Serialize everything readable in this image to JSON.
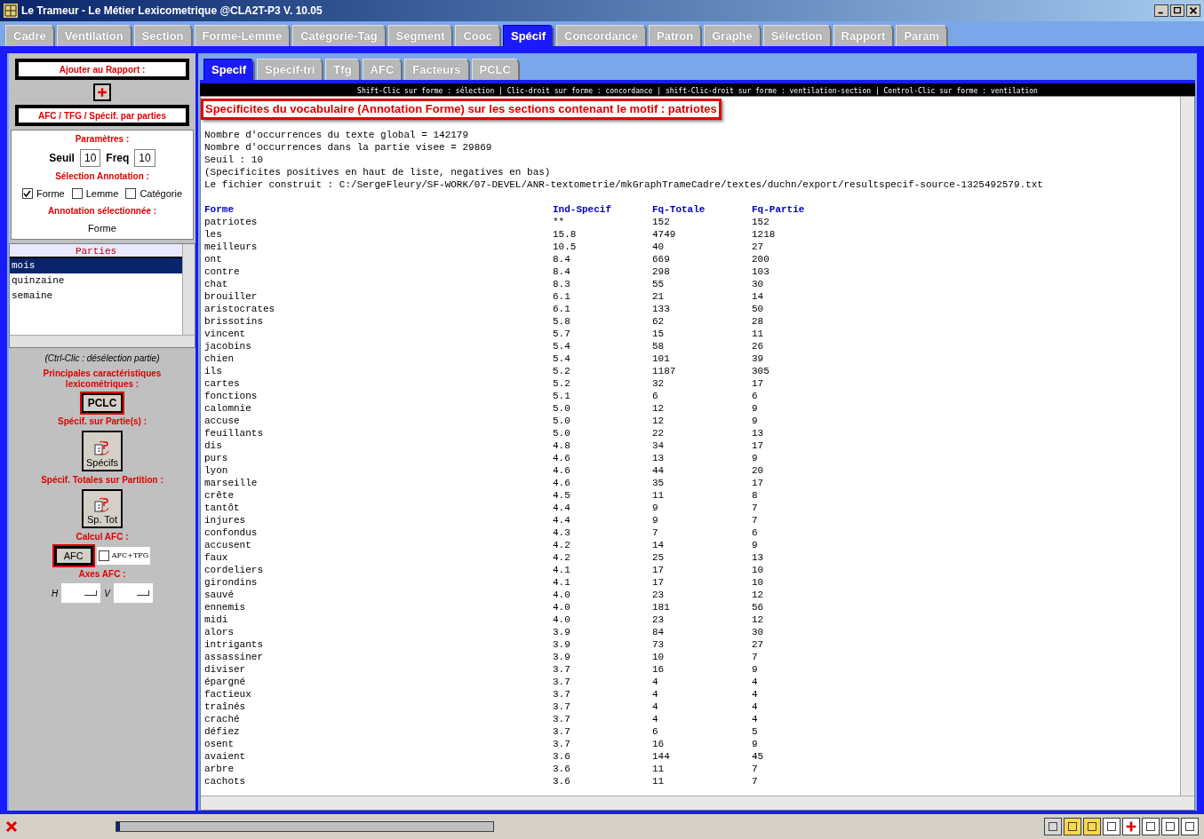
{
  "window": {
    "title": "Le Trameur - Le Métier Lexicometrique @CLA2T-P3 V. 10.05"
  },
  "tabs": [
    {
      "label": "Cadre",
      "selected": false
    },
    {
      "label": "Ventilation",
      "selected": false
    },
    {
      "label": "Section",
      "selected": false
    },
    {
      "label": "Forme-Lemme",
      "selected": false
    },
    {
      "label": "Catégorie-Tag",
      "selected": false
    },
    {
      "label": "Segment",
      "selected": false
    },
    {
      "label": "Cooc",
      "selected": false
    },
    {
      "label": "Spécif",
      "selected": true
    },
    {
      "label": "Concordance",
      "selected": false
    },
    {
      "label": "Patron",
      "selected": false
    },
    {
      "label": "Graphe",
      "selected": false
    },
    {
      "label": "Sélection",
      "selected": false
    },
    {
      "label": "Rapport",
      "selected": false
    },
    {
      "label": "Param",
      "selected": false
    }
  ],
  "sidebar": {
    "add_to_report": "Ajouter au Rapport :",
    "afc_title": "AFC / TFG / Spécif. par parties",
    "params_label": "Paramètres :",
    "seuil_label": "Seuil",
    "seuil_value": "10",
    "freq_label": "Freq",
    "freq_value": "10",
    "annotation_label": "Sélection Annotation :",
    "annotations": [
      {
        "label": "Forme",
        "checked": true
      },
      {
        "label": "Lemme",
        "checked": false
      },
      {
        "label": "Catégorie",
        "checked": false
      }
    ],
    "selected_annotation_label": "Annotation sélectionnée :",
    "selected_annotation": "Forme",
    "parts_header": "Parties",
    "parts": [
      {
        "label": "mois",
        "selected": true
      },
      {
        "label": "quinzaine",
        "selected": false
      },
      {
        "label": "semaine",
        "selected": false
      }
    ],
    "deselect_hint": "(Ctrl-Clic : désélection partie)",
    "pclc_label": "Principales caractéristiques lexicométriques :",
    "pclc_button": "PCLC",
    "specif_label": "Spécif. sur Partie(s) :",
    "specif_button": "Spécifs",
    "total_label": "Spécif. Totales sur Partition :",
    "total_button": "Sp. Tot",
    "afc_label": "Calcul AFC :",
    "afc_button": "AFC",
    "afc_tfg": {
      "label": "AFC+TFG",
      "checked": false
    },
    "axes_label": "Axes AFC :",
    "axis_h": "H",
    "axis_v": "V"
  },
  "status_bar": {
    "progress": {
      "level": 0.01
    }
  },
  "subtabs": [
    {
      "label": "Specif",
      "selected": true
    },
    {
      "label": "Specif-tri",
      "selected": false
    },
    {
      "label": "Tfg",
      "selected": false
    },
    {
      "label": "AFC",
      "selected": false
    },
    {
      "label": "Facteurs",
      "selected": false
    },
    {
      "label": "PCLC",
      "selected": false
    }
  ],
  "hint": "Shift-Clic sur forme : sélection | Clic-droit sur forme : concordance | shift-Clic-droit sur forme : ventilation-section | Control-Clic sur forme : ventilation",
  "result": {
    "heading": "Specificites du vocabulaire (Annotation Forme) sur les sections contenant le motif : patriotes",
    "info": [
      "Nombre d'occurrences du texte global = 142179",
      "Nombre d'occurrences dans la partie visee = 29869",
      "Seuil : 10",
      "(Specificites positives en haut de liste, negatives en bas)",
      "Le fichier construit : C:/SergeFleury/SF-WORK/07-DEVEL/ANR-textometrie/mkGraphTrameCadre/textes/duchn/export/resultspecif-source-1325492579.txt"
    ],
    "columns": [
      "Forme",
      "Ind-Specif",
      "Fq-Totale",
      "Fq-Partie"
    ],
    "rows": [
      [
        "patriotes",
        "**",
        "152",
        "152"
      ],
      [
        "les",
        "15.8",
        "4749",
        "1218"
      ],
      [
        "meilleurs",
        "10.5",
        "40",
        "27"
      ],
      [
        "ont",
        "8.4",
        "669",
        "200"
      ],
      [
        "contre",
        "8.4",
        "298",
        "103"
      ],
      [
        "chat",
        "8.3",
        "55",
        "30"
      ],
      [
        "brouiller",
        "6.1",
        "21",
        "14"
      ],
      [
        "aristocrates",
        "6.1",
        "133",
        "50"
      ],
      [
        "brissotins",
        "5.8",
        "62",
        "28"
      ],
      [
        "vincent",
        "5.7",
        "15",
        "11"
      ],
      [
        "jacobins",
        "5.4",
        "58",
        "26"
      ],
      [
        "chien",
        "5.4",
        "101",
        "39"
      ],
      [
        "ils",
        "5.2",
        "1187",
        "305"
      ],
      [
        "cartes",
        "5.2",
        "32",
        "17"
      ],
      [
        "fonctions",
        "5.1",
        "6",
        "6"
      ],
      [
        "calomnie",
        "5.0",
        "12",
        "9"
      ],
      [
        "accuse",
        "5.0",
        "12",
        "9"
      ],
      [
        "feuillants",
        "5.0",
        "22",
        "13"
      ],
      [
        "dis",
        "4.8",
        "34",
        "17"
      ],
      [
        "purs",
        "4.6",
        "13",
        "9"
      ],
      [
        "lyon",
        "4.6",
        "44",
        "20"
      ],
      [
        "marseille",
        "4.6",
        "35",
        "17"
      ],
      [
        "crête",
        "4.5",
        "11",
        "8"
      ],
      [
        "tantôt",
        "4.4",
        "9",
        "7"
      ],
      [
        "injures",
        "4.4",
        "9",
        "7"
      ],
      [
        "confondus",
        "4.3",
        "7",
        "6"
      ],
      [
        "accusent",
        "4.2",
        "14",
        "9"
      ],
      [
        "faux",
        "4.2",
        "25",
        "13"
      ],
      [
        "cordeliers",
        "4.1",
        "17",
        "10"
      ],
      [
        "girondins",
        "4.1",
        "17",
        "10"
      ],
      [
        "sauvé",
        "4.0",
        "23",
        "12"
      ],
      [
        "ennemis",
        "4.0",
        "181",
        "56"
      ],
      [
        "midi",
        "4.0",
        "23",
        "12"
      ],
      [
        "alors",
        "3.9",
        "84",
        "30"
      ],
      [
        "intrigants",
        "3.9",
        "73",
        "27"
      ],
      [
        "assassiner",
        "3.9",
        "10",
        "7"
      ],
      [
        "diviser",
        "3.7",
        "16",
        "9"
      ],
      [
        "épargné",
        "3.7",
        "4",
        "4"
      ],
      [
        "factieux",
        "3.7",
        "4",
        "4"
      ],
      [
        "traînés",
        "3.7",
        "4",
        "4"
      ],
      [
        "craché",
        "3.7",
        "4",
        "4"
      ],
      [
        "défiez",
        "3.7",
        "6",
        "5"
      ],
      [
        "osent",
        "3.7",
        "16",
        "9"
      ],
      [
        "avaient",
        "3.6",
        "144",
        "45"
      ],
      [
        "arbre",
        "3.6",
        "11",
        "7"
      ],
      [
        "cachots",
        "3.6",
        "11",
        "7"
      ]
    ]
  }
}
